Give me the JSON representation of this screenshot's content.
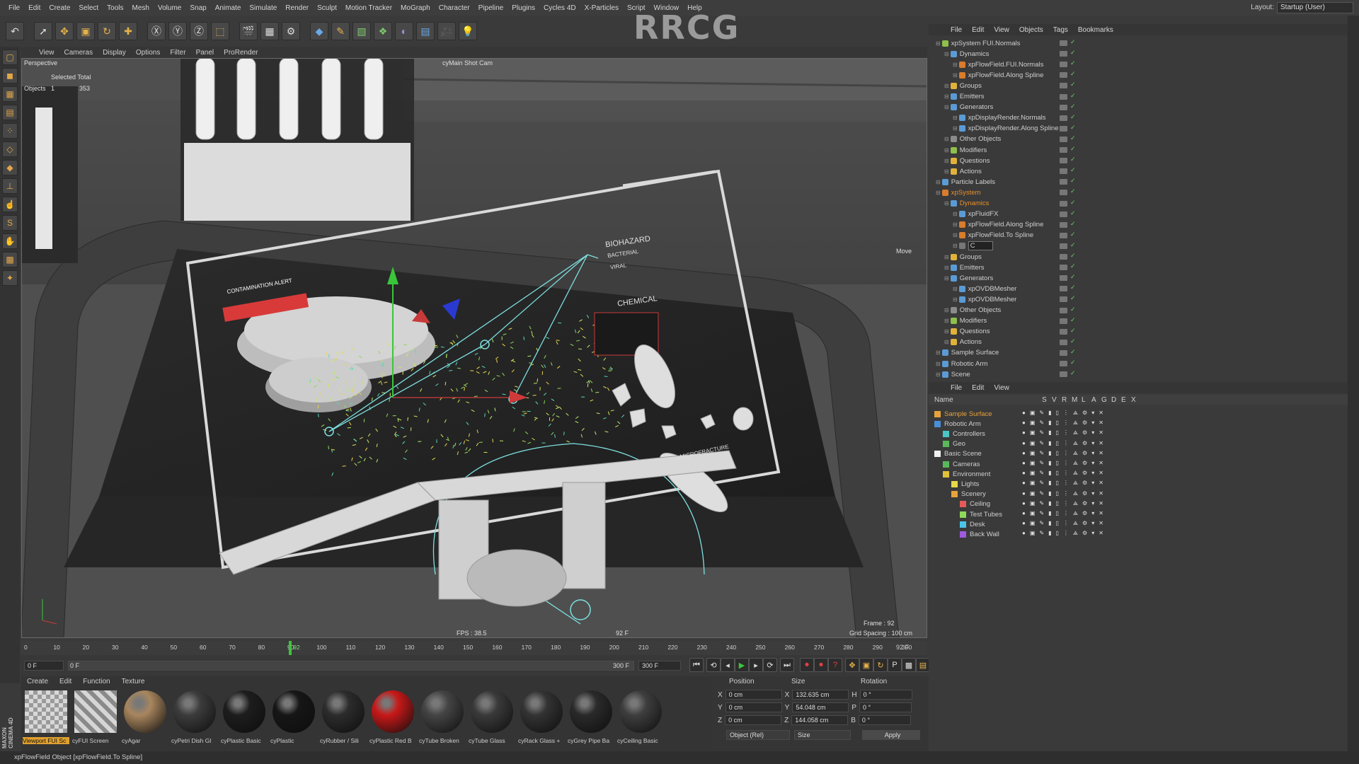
{
  "watermark": "RRCG",
  "menu": [
    "File",
    "Edit",
    "Create",
    "Select",
    "Tools",
    "Mesh",
    "Volume",
    "Snap",
    "Animate",
    "Simulate",
    "Render",
    "Sculpt",
    "Motion Tracker",
    "MoGraph",
    "Character",
    "Pipeline",
    "Plugins",
    "Cycles 4D",
    "X-Particles",
    "Script",
    "Window",
    "Help"
  ],
  "layout": {
    "label": "Layout:",
    "value": "Startup (User)"
  },
  "viewport": {
    "menu": [
      "View",
      "Cameras",
      "Display",
      "Options",
      "Filter",
      "Panel",
      "ProRender"
    ],
    "projection": "Perspective",
    "camera": "cyMain Shot Cam",
    "stats_header": "Selected Total",
    "stats_label": "Objects",
    "stats_selected": "1",
    "stats_total": "353",
    "move_label": "Move",
    "fps": "FPS : 38.5",
    "frame": "Frame : 92",
    "grid": "Grid Spacing : 100 cm",
    "frame_marker": "92 F",
    "scene_labels": {
      "alert": "CONTAMINATION ALERT",
      "biohazard": "BIOHAZARD",
      "bacterial": "BACTERIAL",
      "viral": "VIRAL",
      "chemical": "CHEMICAL",
      "fracture": "MICROFRACTURE"
    }
  },
  "timeline": {
    "ticks": [
      "0",
      "10",
      "20",
      "30",
      "40",
      "50",
      "60",
      "70",
      "80",
      "90",
      "92",
      "100",
      "110",
      "120",
      "130",
      "140",
      "150",
      "160",
      "170",
      "180",
      "190",
      "200",
      "210",
      "220",
      "230",
      "240",
      "250",
      "260",
      "270",
      "280",
      "290",
      "300"
    ],
    "end_label": "92 F",
    "current_frame": 92
  },
  "transport": {
    "start": "0 F",
    "range_start": "0 F",
    "range_end": "300 F",
    "end": "300 F"
  },
  "materials": {
    "menu": [
      "Create",
      "Edit",
      "Function",
      "Texture"
    ],
    "items": [
      {
        "name": "Viewport FUI Sc",
        "color": "#c9c9c9",
        "kind": "checker"
      },
      {
        "name": "cyFUI Screen",
        "color": "#bdbdbd",
        "kind": "stripe"
      },
      {
        "name": "cyAgar",
        "color": "#a9865e",
        "kind": "ball"
      },
      {
        "name": "cyPetri Dish Gl",
        "color": "#3c3c3c",
        "kind": "ball"
      },
      {
        "name": "cyPlastic Basic",
        "color": "#1d1d1d",
        "kind": "ball"
      },
      {
        "name": "cyPlastic",
        "color": "#161616",
        "kind": "ball"
      },
      {
        "name": "cyRubber / Sili",
        "color": "#2c2c2c",
        "kind": "ball"
      },
      {
        "name": "cyPlastic Red B",
        "color": "#c81818",
        "kind": "ball"
      },
      {
        "name": "cyTube Broken",
        "color": "#444",
        "kind": "ball"
      },
      {
        "name": "cyTube Glass",
        "color": "#3a3a3a",
        "kind": "ball"
      },
      {
        "name": "cyRack Glass +",
        "color": "#333",
        "kind": "ball"
      },
      {
        "name": "cyGrey Pipe Ba",
        "color": "#2a2a2a",
        "kind": "ball"
      },
      {
        "name": "cyCeiling Basic",
        "color": "#3e3e3e",
        "kind": "ball"
      }
    ]
  },
  "coords": {
    "headers": [
      "Position",
      "Size",
      "Rotation"
    ],
    "rows": [
      {
        "axis": "X",
        "pos": "0 cm",
        "saxis": "X",
        "size": "132.635 cm",
        "raxis": "H",
        "rot": "0 °"
      },
      {
        "axis": "Y",
        "pos": "0 cm",
        "saxis": "Y",
        "size": "54.048 cm",
        "raxis": "P",
        "rot": "0 °"
      },
      {
        "axis": "Z",
        "pos": "0 cm",
        "saxis": "Z",
        "size": "144.058 cm",
        "raxis": "B",
        "rot": "0 °"
      }
    ],
    "mode": "Object (Rel)",
    "size_mode": "Size",
    "apply": "Apply"
  },
  "objects": {
    "menu": [
      "File",
      "Edit",
      "View",
      "Objects",
      "Tags",
      "Bookmarks"
    ],
    "items": [
      {
        "label": "xpSystem FUI.Normals",
        "indent": 0,
        "color": "#8fbf4d"
      },
      {
        "label": "Dynamics",
        "indent": 1,
        "color": "#5b9bd5"
      },
      {
        "label": "xpFlowField.FUI.Normals",
        "indent": 2,
        "color": "#d97c2b"
      },
      {
        "label": "xpFlowField.Along Spline",
        "indent": 2,
        "color": "#d97c2b"
      },
      {
        "label": "Groups",
        "indent": 1,
        "color": "#e0b23a"
      },
      {
        "label": "Emitters",
        "indent": 1,
        "color": "#5b9bd5"
      },
      {
        "label": "Generators",
        "indent": 1,
        "color": "#5b9bd5"
      },
      {
        "label": "xpDisplayRender.Normals",
        "indent": 2,
        "color": "#5b9bd5"
      },
      {
        "label": "xpDisplayRender.Along Spline",
        "indent": 2,
        "color": "#5b9bd5"
      },
      {
        "label": "Other Objects",
        "indent": 1,
        "color": "#8b8b8b"
      },
      {
        "label": "Modifiers",
        "indent": 1,
        "color": "#8fbf4d"
      },
      {
        "label": "Questions",
        "indent": 1,
        "color": "#e0b23a"
      },
      {
        "label": "Actions",
        "indent": 1,
        "color": "#e0b23a"
      },
      {
        "label": "Particle Labels",
        "indent": 0,
        "color": "#5b9bd5"
      },
      {
        "label": "xpSystem",
        "indent": 0,
        "color": "#d97c2b",
        "hl": true
      },
      {
        "label": "Dynamics",
        "indent": 1,
        "color": "#5b9bd5",
        "hl": true
      },
      {
        "label": "xpFluidFX",
        "indent": 2,
        "color": "#5b9bd5"
      },
      {
        "label": "xpFlowField.Along Spline",
        "indent": 2,
        "color": "#d97c2b"
      },
      {
        "label": "xpFlowField.To Spline",
        "indent": 2,
        "color": "#d97c2b"
      },
      {
        "label": "C",
        "indent": 2,
        "color": "#777",
        "edit": true
      },
      {
        "label": "Groups",
        "indent": 1,
        "color": "#e0b23a"
      },
      {
        "label": "Emitters",
        "indent": 1,
        "color": "#5b9bd5"
      },
      {
        "label": "Generators",
        "indent": 1,
        "color": "#5b9bd5"
      },
      {
        "label": "xpOVDBMesher",
        "indent": 2,
        "color": "#5b9bd5"
      },
      {
        "label": "xpOVDBMesher",
        "indent": 2,
        "color": "#5b9bd5"
      },
      {
        "label": "Other Objects",
        "indent": 1,
        "color": "#8b8b8b"
      },
      {
        "label": "Modifiers",
        "indent": 1,
        "color": "#8fbf4d"
      },
      {
        "label": "Questions",
        "indent": 1,
        "color": "#e0b23a"
      },
      {
        "label": "Actions",
        "indent": 1,
        "color": "#e0b23a"
      },
      {
        "label": "Sample Surface",
        "indent": 0,
        "color": "#5b9bd5"
      },
      {
        "label": "Robotic Arm",
        "indent": 0,
        "color": "#5b9bd5"
      },
      {
        "label": "Scene",
        "indent": 0,
        "color": "#5b9bd5"
      }
    ]
  },
  "layers": {
    "menu": [
      "File",
      "Edit",
      "View"
    ],
    "header_name": "Name",
    "columns": [
      "S",
      "V",
      "R",
      "M",
      "L",
      "A",
      "G",
      "D",
      "E",
      "X"
    ],
    "items": [
      {
        "label": "Sample Surface",
        "indent": 0,
        "color": "#e8a23a",
        "accent": true
      },
      {
        "label": "Robotic Arm",
        "indent": 0,
        "color": "#4a8ed8"
      },
      {
        "label": "Controllers",
        "indent": 1,
        "color": "#4ac6c6"
      },
      {
        "label": "Geo",
        "indent": 1,
        "color": "#5ab85a"
      },
      {
        "label": "Basic Scene",
        "indent": 0,
        "color": "#f0f0f0"
      },
      {
        "label": "Cameras",
        "indent": 1,
        "color": "#5ab85a"
      },
      {
        "label": "Environment",
        "indent": 1,
        "color": "#e0c23a"
      },
      {
        "label": "Lights",
        "indent": 2,
        "color": "#e8d84a"
      },
      {
        "label": "Scenery",
        "indent": 2,
        "color": "#e8a23a"
      },
      {
        "label": "Ceiling",
        "indent": 3,
        "color": "#e85a5a"
      },
      {
        "label": "Test Tubes",
        "indent": 3,
        "color": "#8ed85a"
      },
      {
        "label": "Desk",
        "indent": 3,
        "color": "#4ac6e8"
      },
      {
        "label": "Back Wall",
        "indent": 3,
        "color": "#a05ae0"
      }
    ]
  },
  "status": "xpFlowField Object [xpFlowField.To Spline]",
  "brand": "MAXON CINEMA 4D"
}
